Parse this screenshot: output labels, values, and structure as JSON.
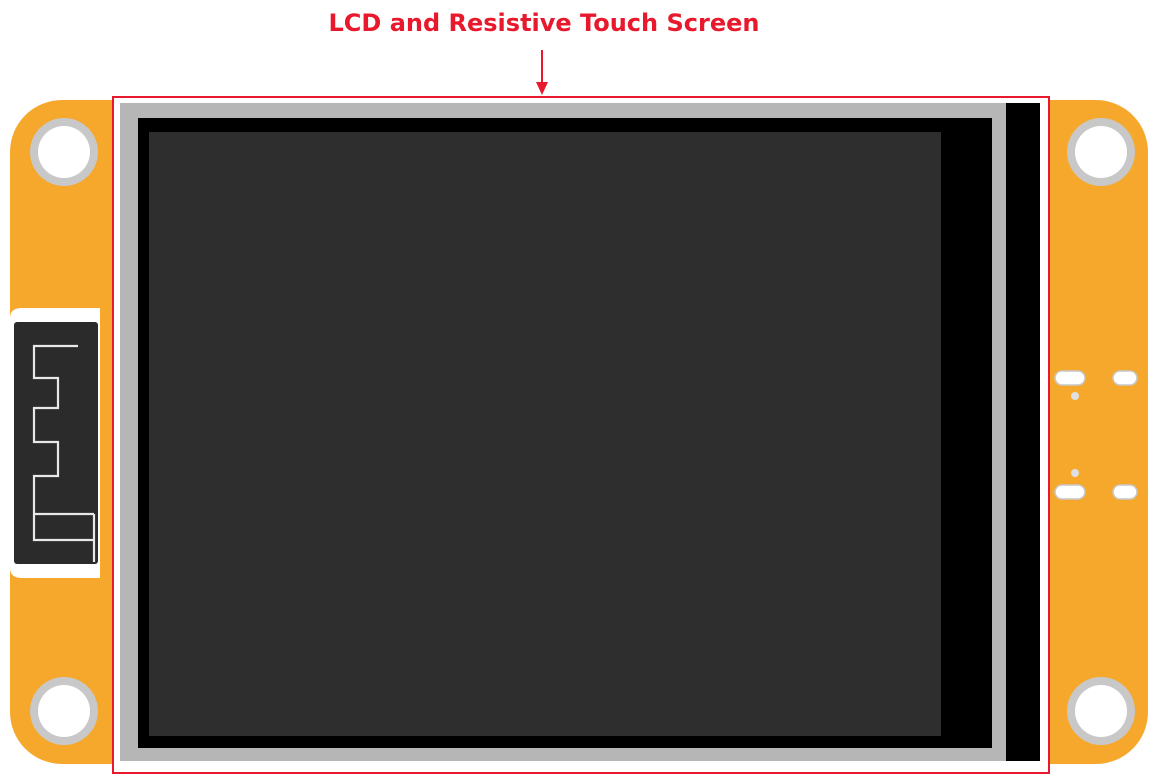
{
  "callout": {
    "label": "LCD and Resistive Touch Screen",
    "color": "#e8192c"
  },
  "colors": {
    "board": "#f6a82c",
    "hole_ring": "#c8c8c8",
    "lcd_bezel": "#b6b6b6",
    "lcd_black": "#000000",
    "display_area": "#2e2e2e",
    "antenna_bg": "#2b2b2b",
    "antenna_trace": "#e8e8e8"
  }
}
